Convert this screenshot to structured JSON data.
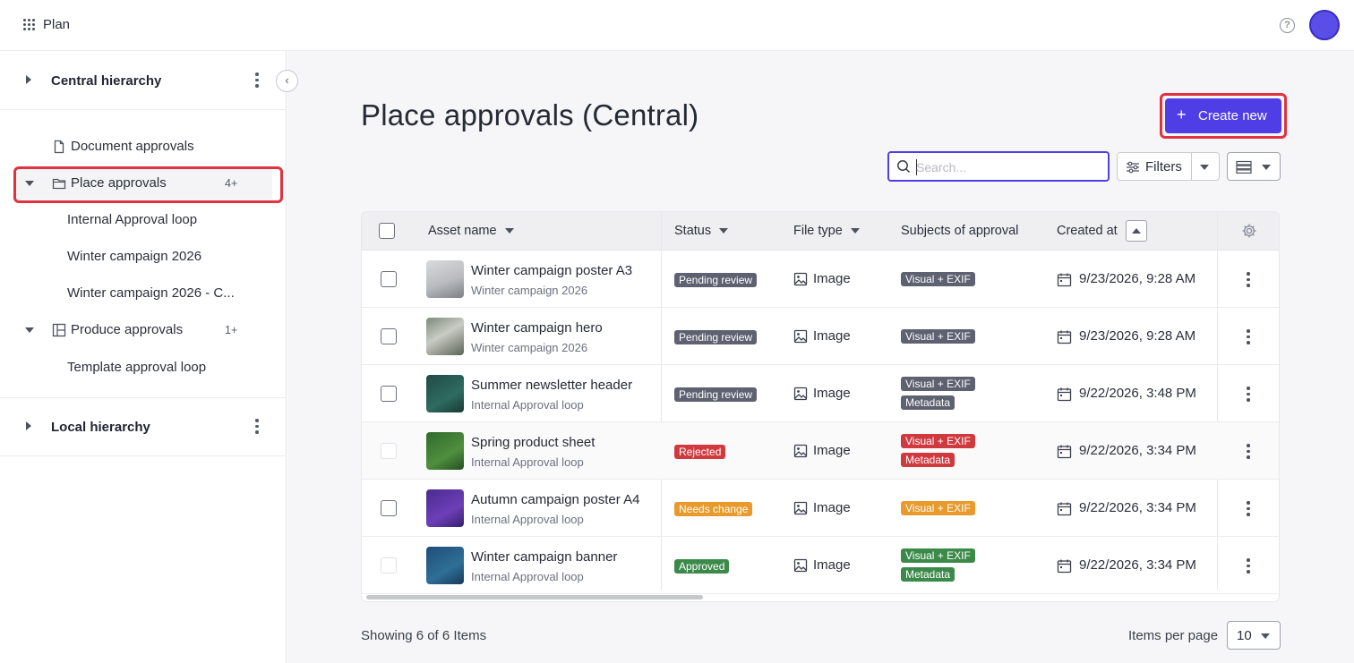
{
  "app": {
    "name": "Plan"
  },
  "sidebar": {
    "central": {
      "title": "Central hierarchy"
    },
    "items": [
      {
        "label": "Document approvals",
        "icon": "document-icon"
      },
      {
        "label": "Place approvals",
        "icon": "folder-icon",
        "count": "4+"
      },
      {
        "label": "Internal Approval loop"
      },
      {
        "label": "Winter campaign 2026"
      },
      {
        "label": "Winter campaign 2026 - C..."
      },
      {
        "label": "Produce approvals",
        "icon": "layout-icon",
        "count": "1+"
      },
      {
        "label": "Template approval loop"
      }
    ],
    "local": {
      "title": "Local hierarchy"
    }
  },
  "main": {
    "title": "Place approvals (Central)",
    "create_label": "Create new",
    "search_placeholder": "Search...",
    "filters_label": "Filters"
  },
  "table": {
    "headers": {
      "asset_name": "Asset name",
      "status": "Status",
      "file_type": "File type",
      "subjects": "Subjects of approval",
      "created_at": "Created at"
    },
    "rows": [
      {
        "name": "Winter campaign poster A3",
        "sub": "Winter campaign 2026",
        "status": "Pending review",
        "status_color": "#5d6170",
        "file_type": "Image",
        "subjects": [
          "Visual + EXIF"
        ],
        "subject_color": "#5d6170",
        "created": "9/23/2026, 9:28 AM"
      },
      {
        "name": "Winter campaign hero",
        "sub": "Winter campaign 2026",
        "status": "Pending review",
        "status_color": "#5d6170",
        "file_type": "Image",
        "subjects": [
          "Visual + EXIF"
        ],
        "subject_color": "#5d6170",
        "created": "9/23/2026, 9:28 AM"
      },
      {
        "name": "Summer newsletter header",
        "sub": "Internal Approval loop",
        "status": "Pending review",
        "status_color": "#5d6170",
        "file_type": "Image",
        "subjects": [
          "Visual + EXIF",
          "Metadata"
        ],
        "subject_color": "#5d6170",
        "created": "9/22/2026, 3:48 PM"
      },
      {
        "name": "Spring product sheet",
        "sub": "Internal Approval loop",
        "status": "Rejected",
        "status_color": "#d03a3f",
        "file_type": "Image",
        "subjects": [
          "Visual + EXIF",
          "Metadata"
        ],
        "subject_color": "#d03a3f",
        "created": "9/22/2026, 3:34 PM"
      },
      {
        "name": "Autumn campaign poster A4",
        "sub": "Internal Approval loop",
        "status": "Needs change",
        "status_color": "#e89a2c",
        "file_type": "Image",
        "subjects": [
          "Visual + EXIF"
        ],
        "subject_color": "#e89a2c",
        "created": "9/22/2026, 3:34 PM"
      },
      {
        "name": "Winter campaign banner",
        "sub": "Internal Approval loop",
        "status": "Approved",
        "status_color": "#3c8a4a",
        "file_type": "Image",
        "subjects": [
          "Visual + EXIF",
          "Metadata"
        ],
        "subject_color": "#3c8a4a",
        "created": "9/22/2026, 3:34 PM"
      }
    ]
  },
  "footer": {
    "showing": "Showing 6 of 6 Items",
    "ipp_label": "Items per page",
    "ipp_value": "10"
  },
  "colors": {
    "accent": "#4f3ee6",
    "highlight": "#e0323f"
  }
}
